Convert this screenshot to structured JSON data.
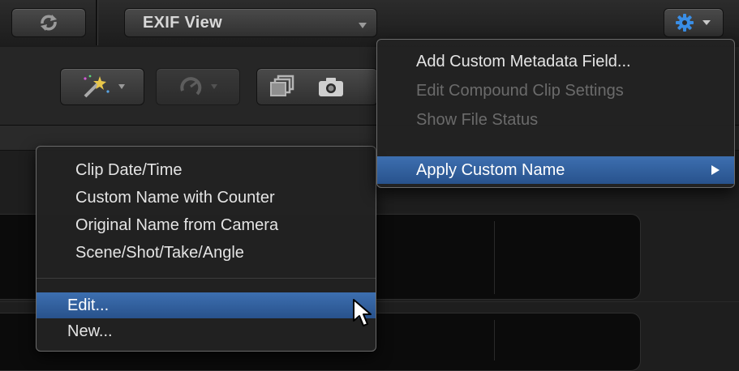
{
  "toolbar": {
    "view_selector": {
      "value": "EXIF View",
      "icon": "chevron-down-icon"
    },
    "icons": {
      "sync": "sync-icon",
      "gear": "gear-icon",
      "magic_wand": "magic-wand-icon",
      "retime": "retime-icon",
      "layers": "layers-icon",
      "camera": "camera-icon"
    }
  },
  "action_menu": {
    "items": [
      {
        "label": "Add Custom Metadata Field...",
        "enabled": true
      },
      {
        "label": "Edit Compound Clip Settings",
        "enabled": false
      },
      {
        "label": "Show File Status",
        "enabled": false
      },
      {
        "label": "Apply Custom Name",
        "enabled": true,
        "highlighted": true,
        "submenu": true
      }
    ]
  },
  "submenu": {
    "presets": [
      "Clip Date/Time",
      "Custom Name with Counter",
      "Original Name from Camera",
      "Scene/Shot/Take/Angle"
    ],
    "edit_label": "Edit...",
    "new_label": "New..."
  },
  "colors": {
    "highlight": "#2f5e9e",
    "menu_bg": "#222222",
    "text": "#e4e4e4",
    "disabled_text": "#6b6b6b",
    "gear_blue": "#3a8ee6"
  }
}
